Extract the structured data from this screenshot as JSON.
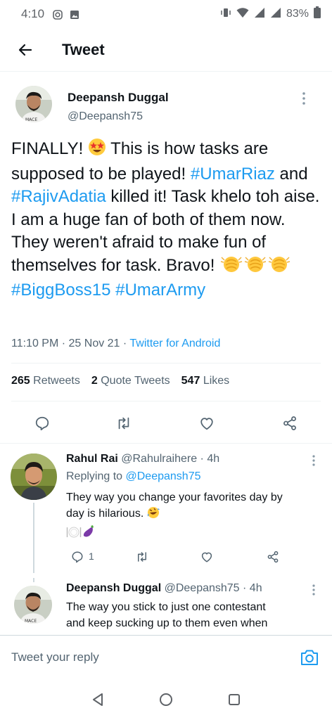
{
  "status_bar": {
    "time": "4:10",
    "battery": "83%"
  },
  "header": {
    "title": "Tweet"
  },
  "tweet": {
    "author": "Deepansh Duggal",
    "handle": "@Deepansh75",
    "text_parts": {
      "p1": "FINALLY! ",
      "p2": " This is how tasks are supposed to be played! ",
      "tag1": "#UmarRiaz",
      "p3": " and ",
      "tag2": "#RajivAdatia",
      "p4": " killed it! Task khelo toh aise. I am a huge fan of both of them now. They weren't afraid to make fun of themselves for task. Bravo! ",
      "tag3": "#BiggBoss15",
      "tag4": "#UmarArmy"
    },
    "time": "11:10 PM",
    "date": "25 Nov 21",
    "source": "Twitter for Android",
    "stats": {
      "retweets": "265",
      "retweets_label": "Retweets",
      "quotes": "2",
      "quotes_label": "Quote Tweets",
      "likes": "547",
      "likes_label": "Likes"
    }
  },
  "replies": [
    {
      "author": "Rahul Rai",
      "handle_time": "@Rahulraihere · 4h",
      "replying_label": "Replying to ",
      "replying_to": "@Deepansh75",
      "text_line1": "They way you change your favorites day by",
      "text_line2": "day is hilarious. ",
      "reply_count": "1"
    },
    {
      "author": "Deepansh Duggal",
      "handle_time": "@Deepansh75 · 4h",
      "text_line1": "The way you stick to just one contestant",
      "text_line2": "and keep sucking up to them even when"
    }
  ],
  "compose": {
    "placeholder": "Tweet your reply"
  },
  "colors": {
    "accent": "#1d9bf0",
    "text": "#0f1419",
    "muted": "#536471"
  },
  "icons": [
    "back-arrow-icon",
    "more-vertical-icon",
    "reply-icon",
    "retweet-icon",
    "like-icon",
    "share-icon",
    "camera-icon",
    "nav-back-icon",
    "nav-home-icon",
    "nav-recents-icon"
  ]
}
